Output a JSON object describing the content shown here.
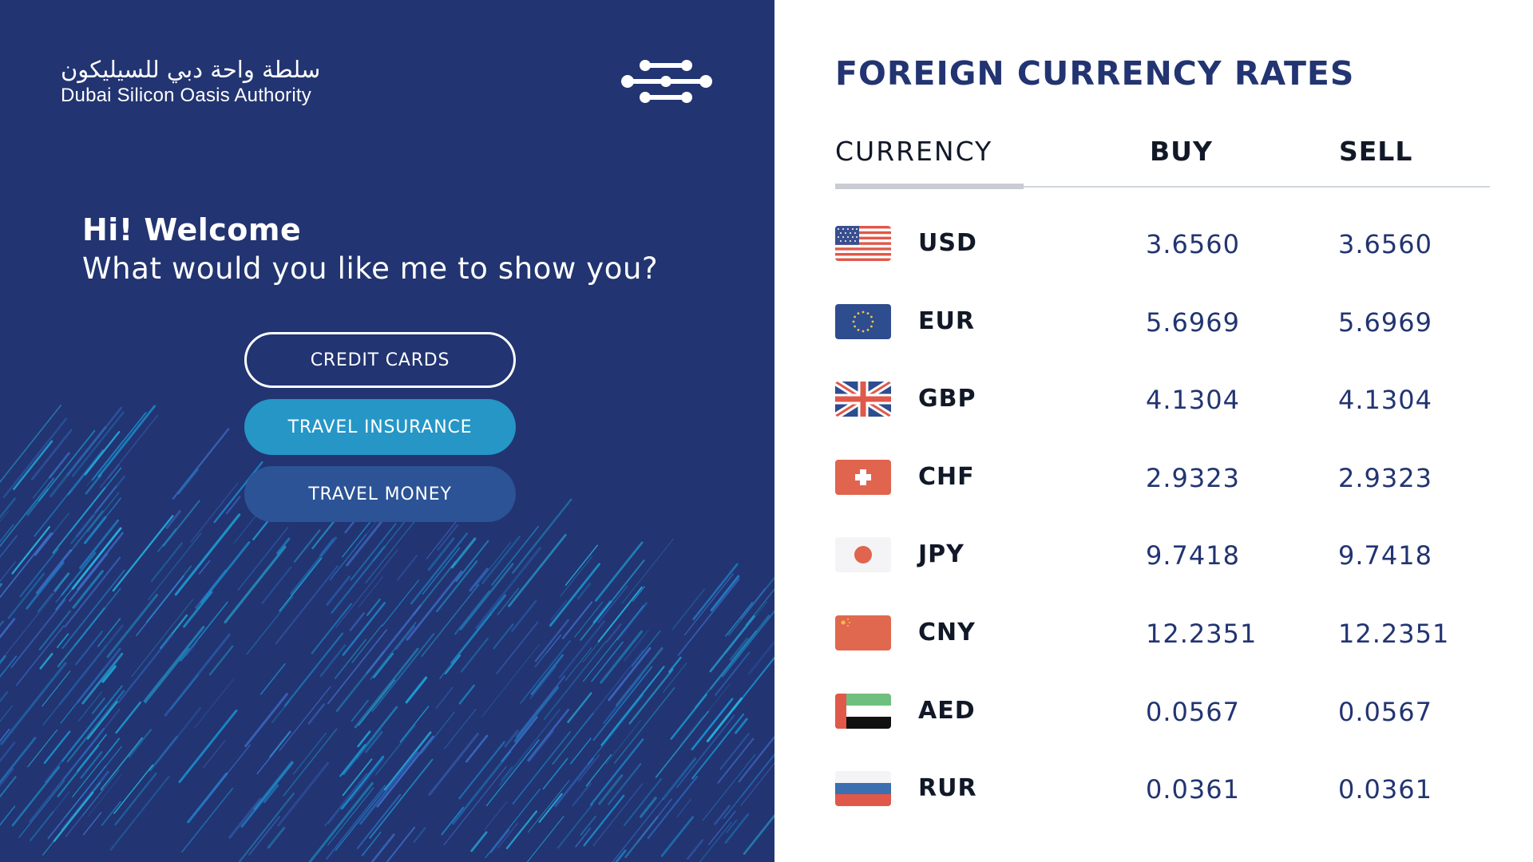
{
  "logo": {
    "arabic": "سلطة واحة دبي للسيليكون",
    "english": "Dubai Silicon Oasis Authority",
    "mark_icon": "dsoa-circuit-logo-icon"
  },
  "welcome": {
    "title": "Hi! Welcome",
    "subtitle": "What would you like me to show you?"
  },
  "buttons": {
    "credit_cards": "CREDIT CARDS",
    "travel_insurance": "TRAVEL INSURANCE",
    "travel_money": "TRAVEL MONEY"
  },
  "rates": {
    "title": "FOREIGN CURRENCY RATES",
    "headers": {
      "currency": "CURRENCY",
      "buy": "BUY",
      "sell": "SELL"
    },
    "rows": [
      {
        "code": "USD",
        "buy": "3.6560",
        "sell": "3.6560",
        "flag": "us-flag-icon"
      },
      {
        "code": "EUR",
        "buy": "5.6969",
        "sell": "5.6969",
        "flag": "eu-flag-icon"
      },
      {
        "code": "GBP",
        "buy": "4.1304",
        "sell": "4.1304",
        "flag": "uk-flag-icon"
      },
      {
        "code": "CHF",
        "buy": "2.9323",
        "sell": "2.9323",
        "flag": "swiss-flag-icon"
      },
      {
        "code": "JPY",
        "buy": "9.7418",
        "sell": "9.7418",
        "flag": "japan-flag-icon"
      },
      {
        "code": "CNY",
        "buy": "12.2351",
        "sell": "12.2351",
        "flag": "china-flag-icon"
      },
      {
        "code": "AED",
        "buy": "0.0567",
        "sell": "0.0567",
        "flag": "uae-flag-icon"
      },
      {
        "code": "RUR",
        "buy": "0.0361",
        "sell": "0.0361",
        "flag": "russia-flag-icon"
      }
    ]
  },
  "colors": {
    "panel_bg": "#223471",
    "accent_teal": "#2596c6",
    "button_blue": "#2b5396",
    "title_navy": "#223471"
  }
}
